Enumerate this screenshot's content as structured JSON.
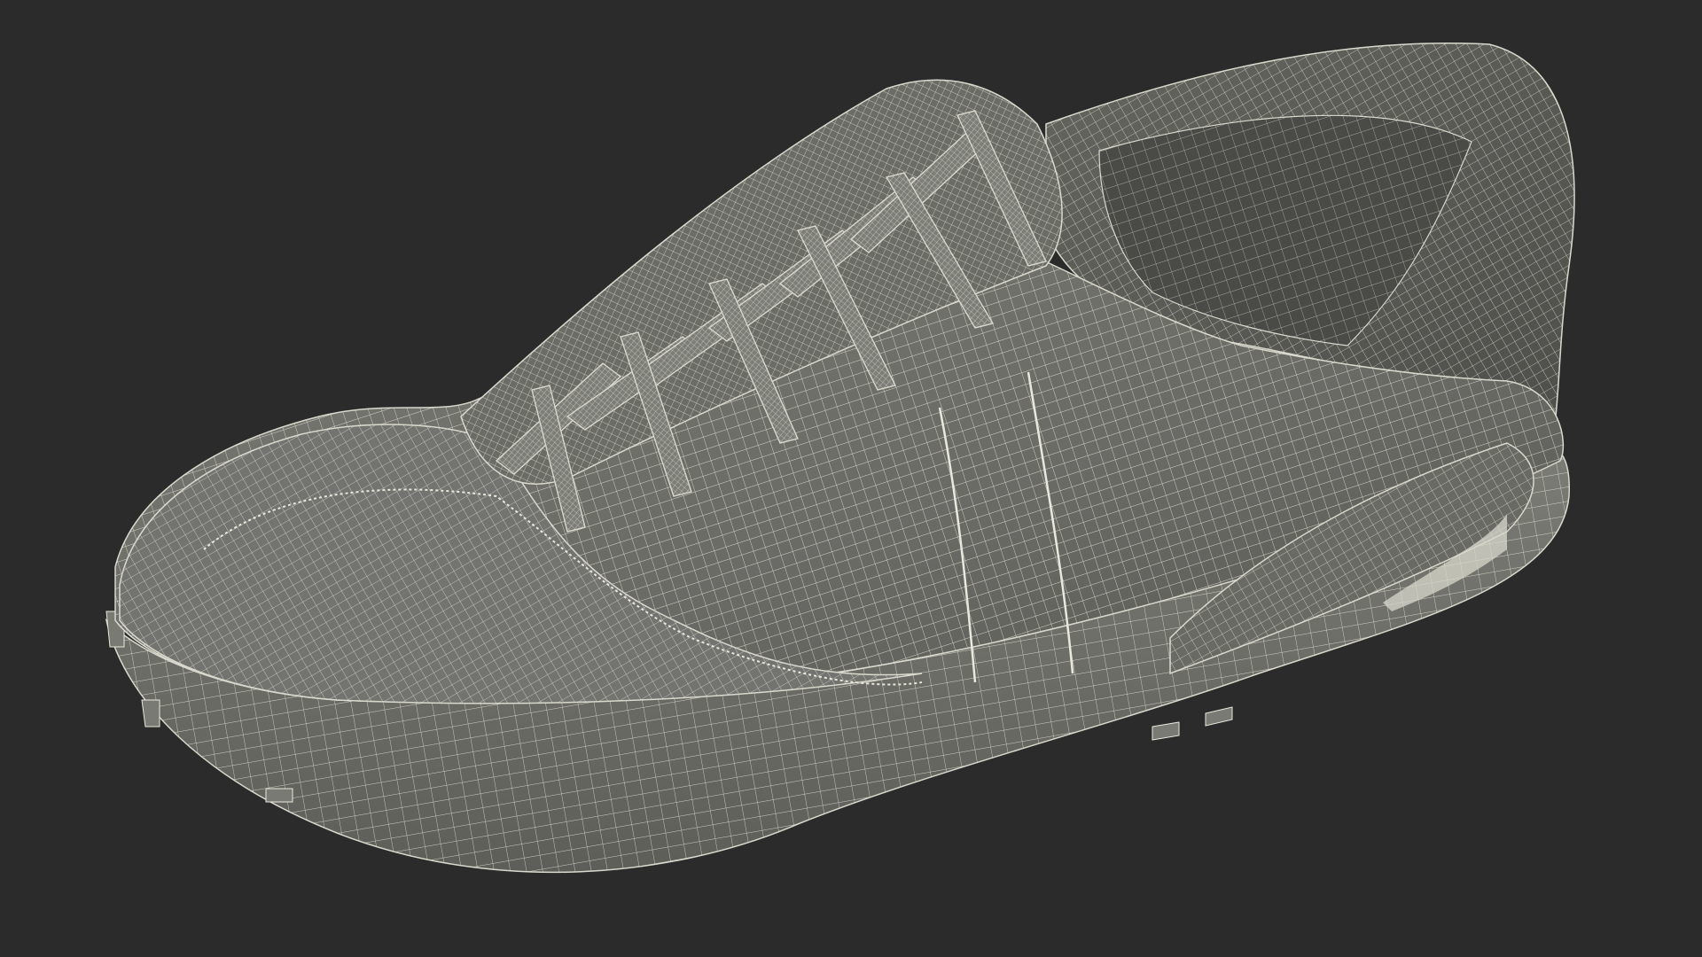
{
  "scene": {
    "subject": "sneaker-wireframe-render",
    "colors": {
      "background": "#2b2b2b",
      "surface": "#6f6f6a",
      "surface_dark": "#5a5a56",
      "surface_light": "#85857f",
      "wire": "#e8e8dc",
      "highlight": "#d8d8cc"
    }
  }
}
